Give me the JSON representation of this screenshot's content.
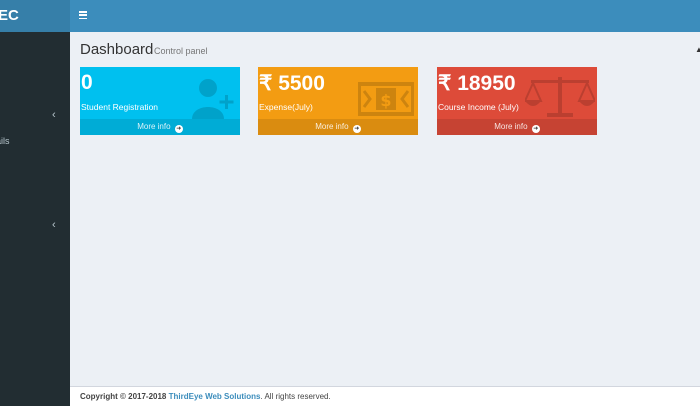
{
  "app": {
    "logo_text": "EC"
  },
  "sidebar": {
    "item_label": "ails"
  },
  "header": {
    "menu_icon": "hamburger-icon"
  },
  "content": {
    "title": "Dashboard",
    "subtitle": "Control panel"
  },
  "boxes": [
    {
      "number": "0",
      "label": "Student Registration",
      "footer": "More info",
      "icon": "user-plus-icon",
      "color": "#00c0ef"
    },
    {
      "number": "₹ 5500",
      "label": "Expense(July)",
      "footer": "More info",
      "icon": "money-icon",
      "color": "#f39c12"
    },
    {
      "number": "₹ 18950",
      "label": "Course Income (July)",
      "footer": "More info",
      "icon": "balance-scale-icon",
      "color": "#dd4b39"
    }
  ],
  "footer": {
    "copyright": "Copyright © 2017-2018",
    "company": "ThirdEye Web Solutions",
    "rights": ". All rights reserved."
  }
}
